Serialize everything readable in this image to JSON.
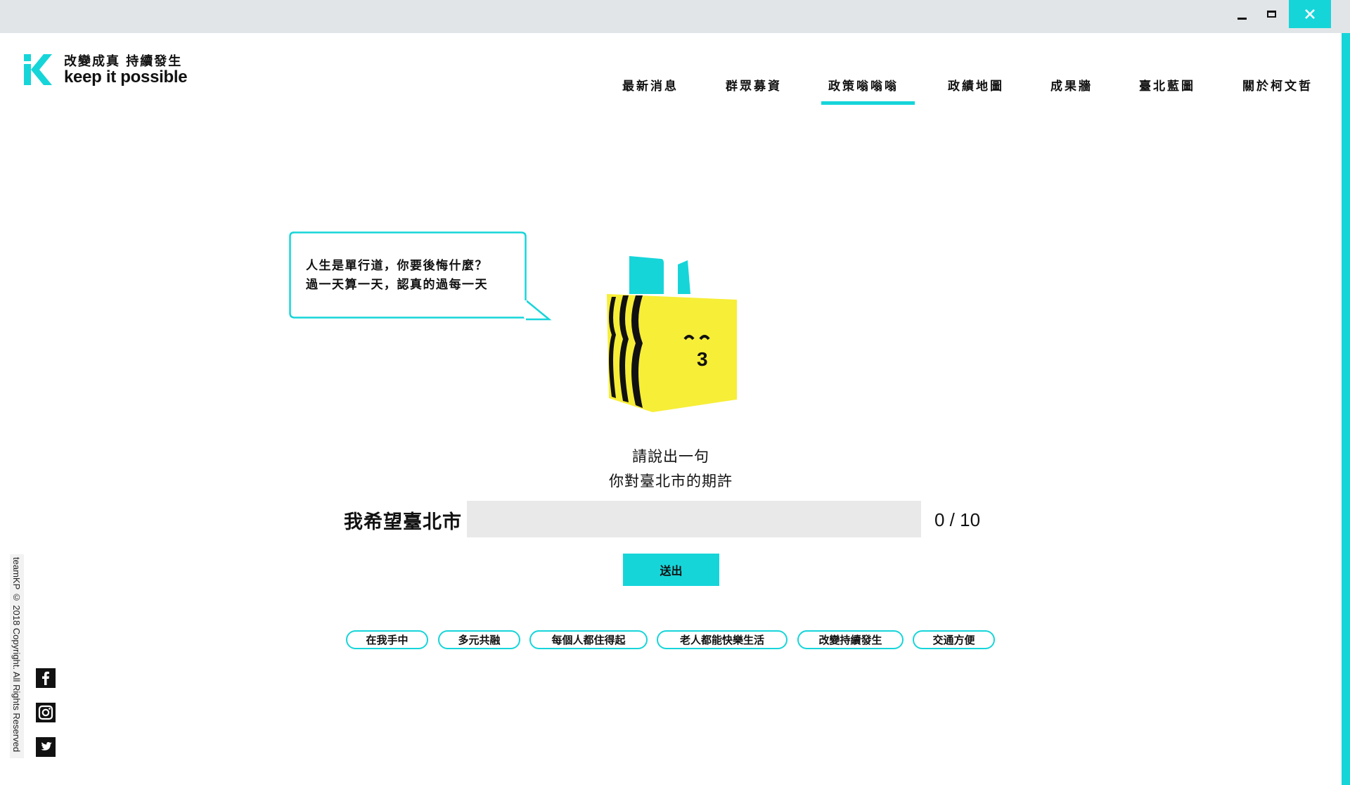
{
  "window": {
    "minimize_icon": "minimize-icon",
    "maximize_icon": "maximize-icon",
    "close_icon": "close-icon",
    "close_color": "#16d5d9"
  },
  "brand": {
    "slogan_zh": "改變成真 持續發生",
    "slogan_en": "keep it possible",
    "accent_color": "#16d5d9"
  },
  "nav": {
    "items": [
      {
        "label": "最新消息"
      },
      {
        "label": "群眾募資"
      },
      {
        "label": "政策嗡嗡嗡",
        "active": true
      },
      {
        "label": "政績地圖"
      },
      {
        "label": "成果牆"
      },
      {
        "label": "臺北藍圖"
      },
      {
        "label": "關於柯文哲"
      }
    ]
  },
  "bubble": {
    "line1": "人生是單行道，你要後悔什麼？",
    "line2": "過一天算一天，認真的過每一天"
  },
  "mascot": {
    "face_text": "3"
  },
  "prompt": {
    "line1": "請說出一句",
    "line2": "你對臺北市的期許"
  },
  "wish": {
    "label": "我希望臺北市",
    "value": "",
    "placeholder": "",
    "counter": "0 / 10"
  },
  "submit_label": "送出",
  "tags": [
    "在我手中",
    "多元共融",
    "每個人都住得起",
    "老人都能快樂生活",
    "改變持續發生",
    "交通方便"
  ],
  "footer": {
    "copyright": "teamKP © 2018 Copyright. All Rights Reserved",
    "social_icons": [
      "facebook-icon",
      "instagram-icon",
      "twitter-icon"
    ]
  }
}
